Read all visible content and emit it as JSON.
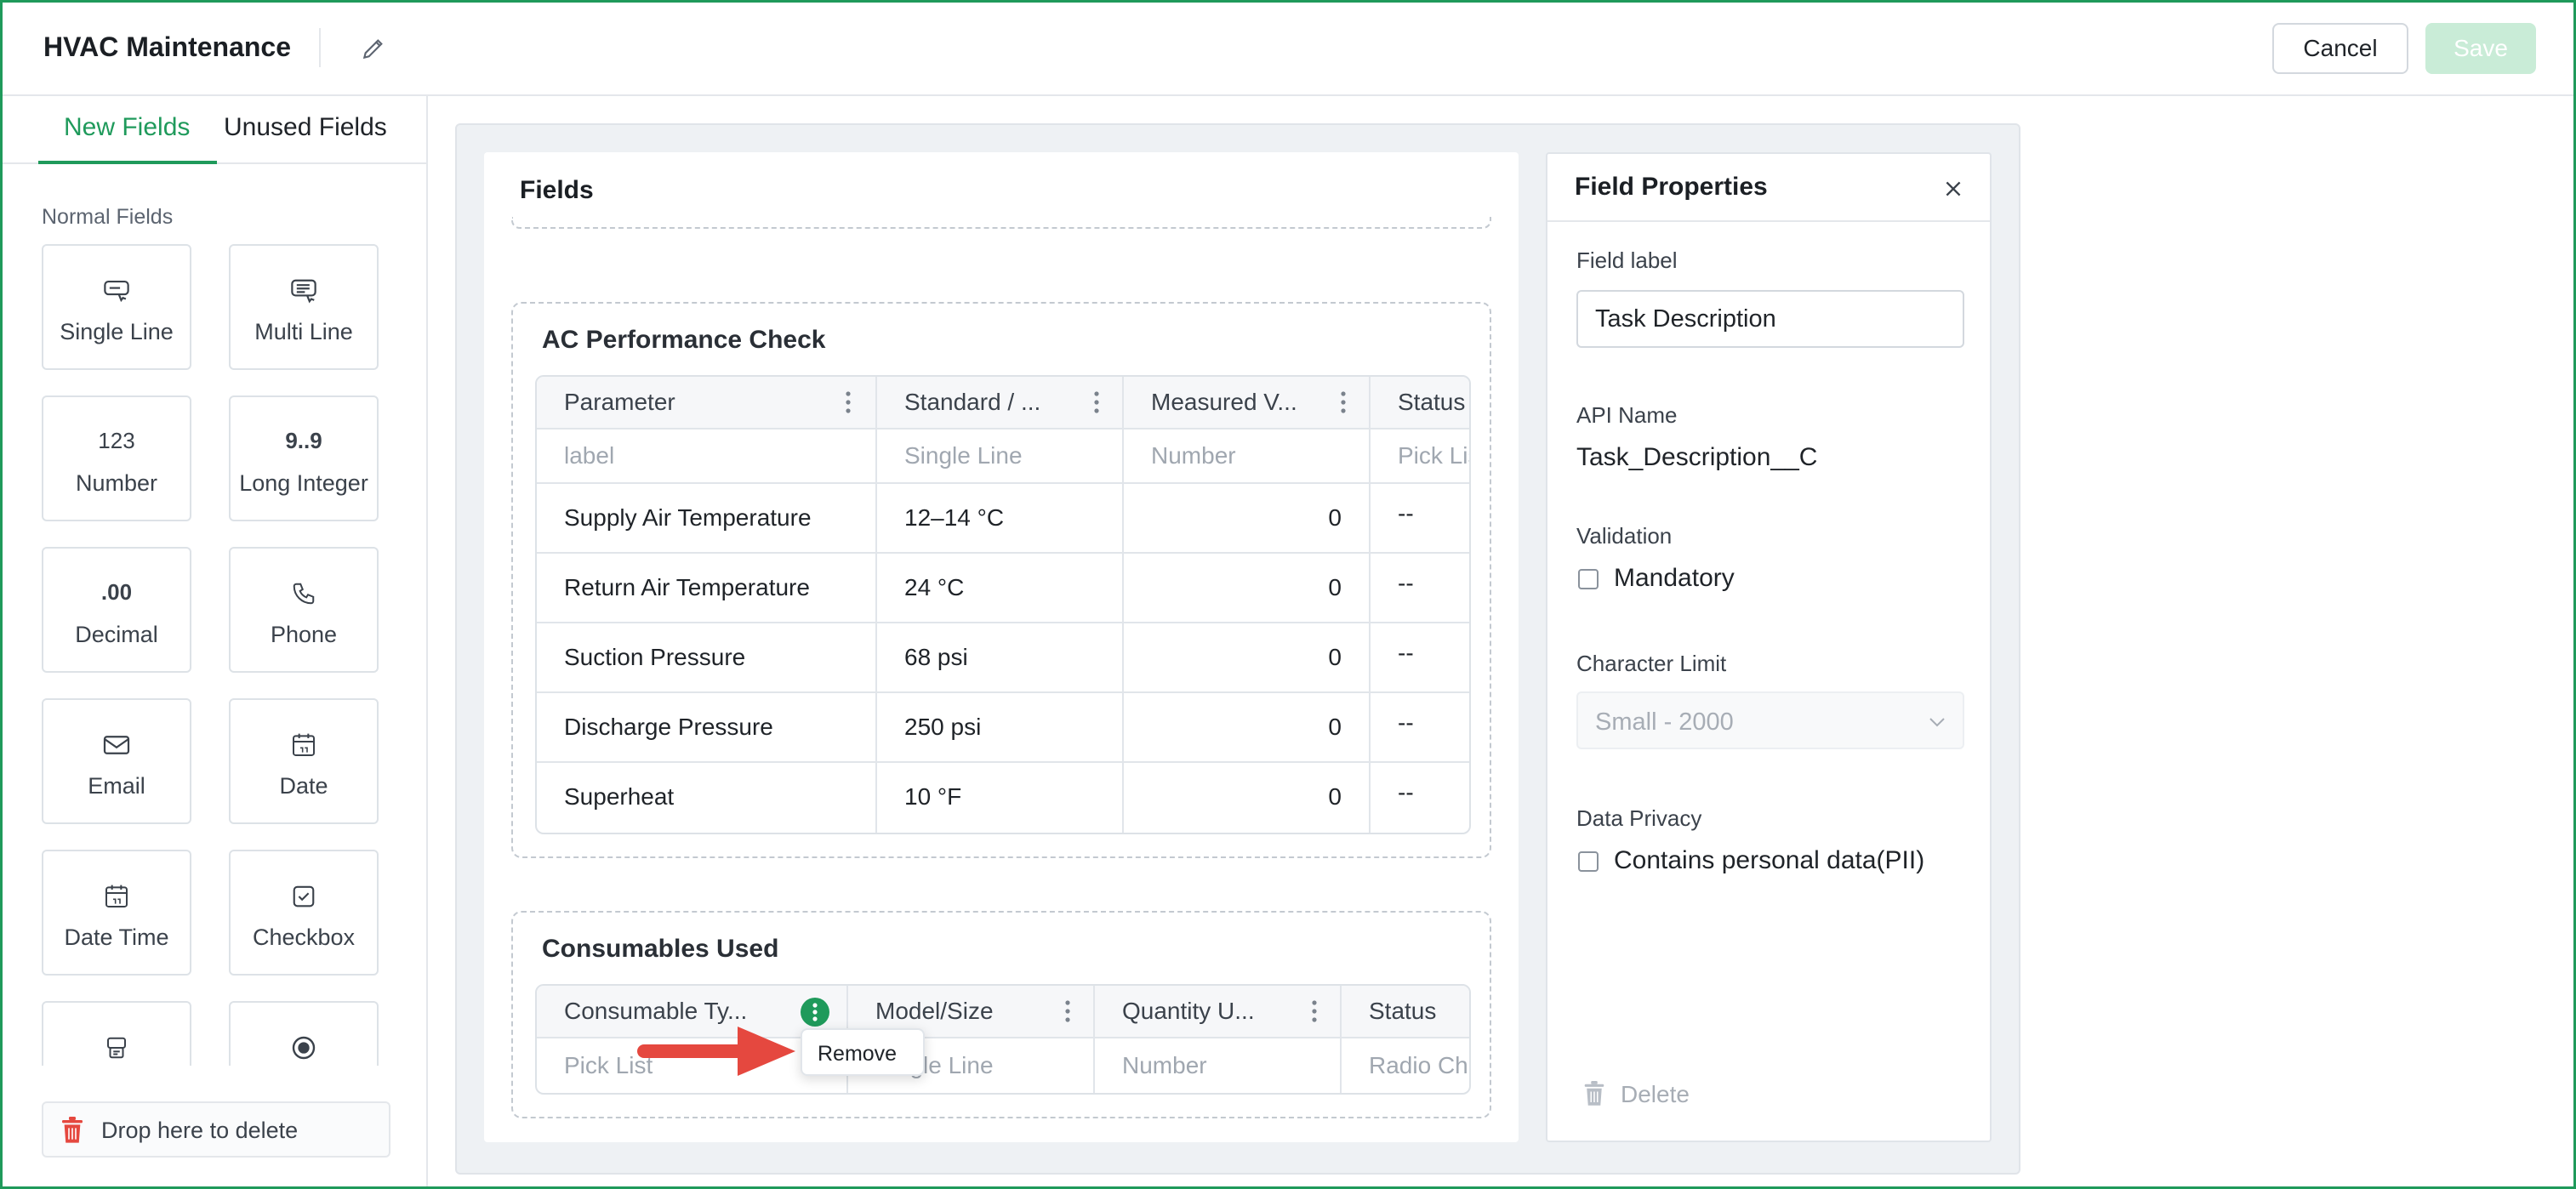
{
  "header": {
    "title": "HVAC Maintenance",
    "cancel_label": "Cancel",
    "save_label": "Save"
  },
  "sidebar": {
    "tabs": [
      {
        "label": "New Fields",
        "active": true
      },
      {
        "label": "Unused Fields",
        "active": false
      }
    ],
    "section_label": "Normal Fields",
    "tiles": [
      {
        "label": "Single Line",
        "icon": "single-line-icon"
      },
      {
        "label": "Multi Line",
        "icon": "multi-line-icon"
      },
      {
        "label": "Number",
        "icon": "number-icon",
        "glyph": "123"
      },
      {
        "label": "Long Integer",
        "icon": "long-integer-icon",
        "glyph": "9..9"
      },
      {
        "label": "Decimal",
        "icon": "decimal-icon",
        "glyph": ".00"
      },
      {
        "label": "Phone",
        "icon": "phone-icon"
      },
      {
        "label": "Email",
        "icon": "email-icon"
      },
      {
        "label": "Date",
        "icon": "date-icon"
      },
      {
        "label": "Date Time",
        "icon": "date-time-icon"
      },
      {
        "label": "Checkbox",
        "icon": "checkbox-icon"
      },
      {
        "label": "",
        "icon": "pick-list-icon"
      },
      {
        "label": "",
        "icon": "radio-icon"
      }
    ],
    "drop_delete_label": "Drop here to delete"
  },
  "fields": {
    "title": "Fields",
    "sections": [
      {
        "title": "AC Performance Check",
        "columns": [
          "Parameter",
          "Standard / ...",
          "Measured V...",
          "Status"
        ],
        "types": [
          "label",
          "Single Line",
          "Number",
          "Pick Lis"
        ],
        "rows": [
          [
            "Supply Air Temperature",
            "12–14 °C",
            "0",
            "--"
          ],
          [
            "Return Air Temperature",
            "24 °C",
            "0",
            "--"
          ],
          [
            "Suction Pressure",
            "68 psi",
            "0",
            "--"
          ],
          [
            "Discharge Pressure",
            "250 psi",
            "0",
            "--"
          ],
          [
            "Superheat",
            "10 °F",
            "0",
            "--"
          ]
        ]
      },
      {
        "title": "Consumables Used",
        "columns": [
          "Consumable Ty...",
          "Model/Size",
          "Quantity U...",
          "Status"
        ],
        "types": [
          "Pick List",
          "Single Line",
          "Number",
          "Radio Ch"
        ]
      }
    ],
    "popover_label": "Remove"
  },
  "properties": {
    "title": "Field Properties",
    "field_label_label": "Field label",
    "field_label_value": "Task Description",
    "api_name_label": "API Name",
    "api_name_value": "Task_Description__C",
    "validation_label": "Validation",
    "mandatory_label": "Mandatory",
    "char_limit_label": "Character Limit",
    "char_limit_value": "Small - 2000",
    "privacy_label": "Data Privacy",
    "privacy_option_label": "Contains personal data(PII)",
    "delete_label": "Delete"
  },
  "colors": {
    "accent": "#1f9a5b",
    "save_disabled": "#c9ecd7",
    "arrow": "#e5483f",
    "canvas_bg": "#eef1f4"
  }
}
